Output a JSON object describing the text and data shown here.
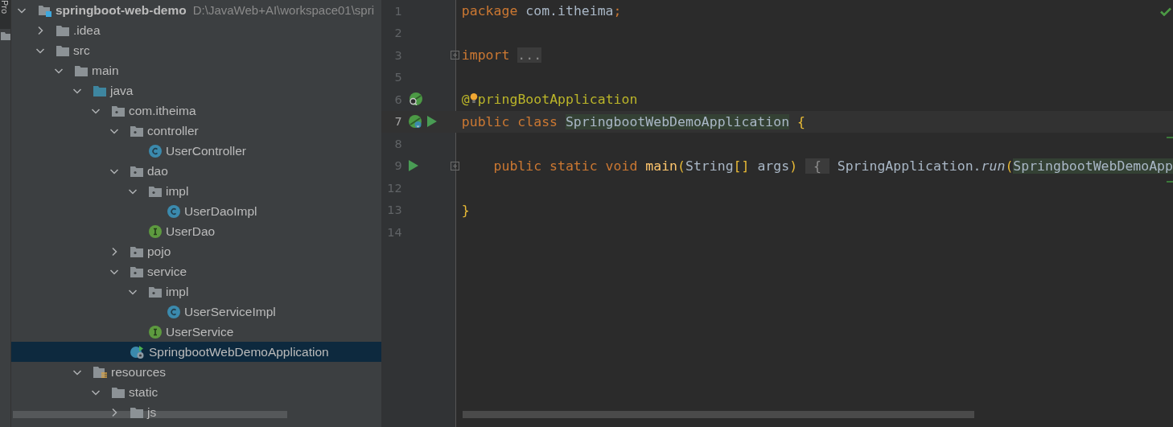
{
  "tool_strip": {
    "tab_label": "Pro",
    "selected": true
  },
  "project_tree": [
    {
      "label": "springboot-web-demo",
      "kind": "module",
      "path": "D:\\JavaWeb+AI\\workspace01\\spri",
      "expanded": true,
      "selected": false,
      "children": [
        {
          "label": ".idea",
          "kind": "folder",
          "expanded": false,
          "selected": false
        },
        {
          "label": "src",
          "kind": "folder",
          "expanded": true,
          "selected": false,
          "children": [
            {
              "label": "main",
              "kind": "folder",
              "expanded": true,
              "selected": false,
              "children": [
                {
                  "label": "java",
                  "kind": "source-folder",
                  "expanded": true,
                  "selected": false,
                  "children": [
                    {
                      "label": "com.itheima",
                      "kind": "package",
                      "expanded": true,
                      "selected": false,
                      "children": [
                        {
                          "label": "controller",
                          "kind": "package",
                          "expanded": true,
                          "selected": false,
                          "children": [
                            {
                              "label": "UserController",
                              "kind": "class",
                              "selected": false
                            }
                          ]
                        },
                        {
                          "label": "dao",
                          "kind": "package",
                          "expanded": true,
                          "selected": false,
                          "children": [
                            {
                              "label": "impl",
                              "kind": "package",
                              "expanded": true,
                              "selected": false,
                              "children": [
                                {
                                  "label": "UserDaoImpl",
                                  "kind": "class",
                                  "selected": false
                                }
                              ]
                            },
                            {
                              "label": "UserDao",
                              "kind": "interface",
                              "selected": false
                            }
                          ]
                        },
                        {
                          "label": "pojo",
                          "kind": "package",
                          "expanded": false,
                          "selected": false
                        },
                        {
                          "label": "service",
                          "kind": "package",
                          "expanded": true,
                          "selected": false,
                          "children": [
                            {
                              "label": "impl",
                              "kind": "package",
                              "expanded": true,
                              "selected": false,
                              "children": [
                                {
                                  "label": "UserServiceImpl",
                                  "kind": "class",
                                  "selected": false
                                }
                              ]
                            },
                            {
                              "label": "UserService",
                              "kind": "interface",
                              "selected": false
                            }
                          ]
                        },
                        {
                          "label": "SpringbootWebDemoApplication",
                          "kind": "spring-app",
                          "selected": true
                        }
                      ]
                    }
                  ]
                },
                {
                  "label": "resources",
                  "kind": "resources-folder",
                  "expanded": true,
                  "selected": false,
                  "children": [
                    {
                      "label": "static",
                      "kind": "folder",
                      "expanded": true,
                      "selected": false,
                      "children": [
                        {
                          "label": "js",
                          "kind": "folder",
                          "expanded": false,
                          "selected": false
                        }
                      ]
                    }
                  ]
                }
              ]
            }
          ]
        }
      ]
    }
  ],
  "editor": {
    "inspection_ok": true,
    "lines": [
      {
        "number": "1",
        "current": false,
        "tokens": [
          {
            "text": "package ",
            "kind": "keyword"
          },
          {
            "text": "com.itheima",
            "kind": "plain"
          },
          {
            "text": ";",
            "kind": "keyword"
          }
        ]
      },
      {
        "number": "2",
        "current": false
      },
      {
        "number": "3",
        "current": false,
        "fold": true,
        "tokens": [
          {
            "text": "import ",
            "kind": "keyword"
          },
          {
            "text": "...",
            "kind": "folded"
          }
        ]
      },
      {
        "number": "5",
        "current": false
      },
      {
        "number": "6",
        "current": false,
        "bean_search": true,
        "tokens": [
          {
            "text": "@",
            "kind": "annotation"
          },
          {
            "kind": "bulb"
          },
          {
            "text": "pringBootApplication",
            "kind": "annotation"
          }
        ]
      },
      {
        "number": "7",
        "current": true,
        "bean_marker": true,
        "run_button": true,
        "tokens": [
          {
            "text": "public class ",
            "kind": "keyword"
          },
          {
            "text": "SpringbootWebDemoApplication",
            "kind": "usage"
          },
          {
            "text": " {",
            "kind": "bracket"
          }
        ]
      },
      {
        "number": "8",
        "current": false
      },
      {
        "number": "9",
        "current": false,
        "run_button": true,
        "fold": true,
        "tokens": [
          {
            "text": "    public static void ",
            "kind": "keyword"
          },
          {
            "text": "main",
            "kind": "method"
          },
          {
            "text": "(",
            "kind": "bracket"
          },
          {
            "text": "String",
            "kind": "plain"
          },
          {
            "text": "[]",
            "kind": "bracket"
          },
          {
            "text": " args",
            "kind": "plain"
          },
          {
            "text": ") ",
            "kind": "bracket"
          },
          {
            "text": " { ",
            "kind": "folded"
          },
          {
            "text": " SpringApplication.",
            "kind": "plain"
          },
          {
            "text": "run",
            "kind": "static-call"
          },
          {
            "text": "(",
            "kind": "bracket"
          },
          {
            "text": "SpringbootWebDemoApp",
            "kind": "usage"
          }
        ]
      },
      {
        "number": "12",
        "current": false
      },
      {
        "number": "13",
        "current": false,
        "tokens": [
          {
            "text": "}",
            "kind": "bracket"
          }
        ]
      },
      {
        "number": "14",
        "current": false
      }
    ]
  }
}
